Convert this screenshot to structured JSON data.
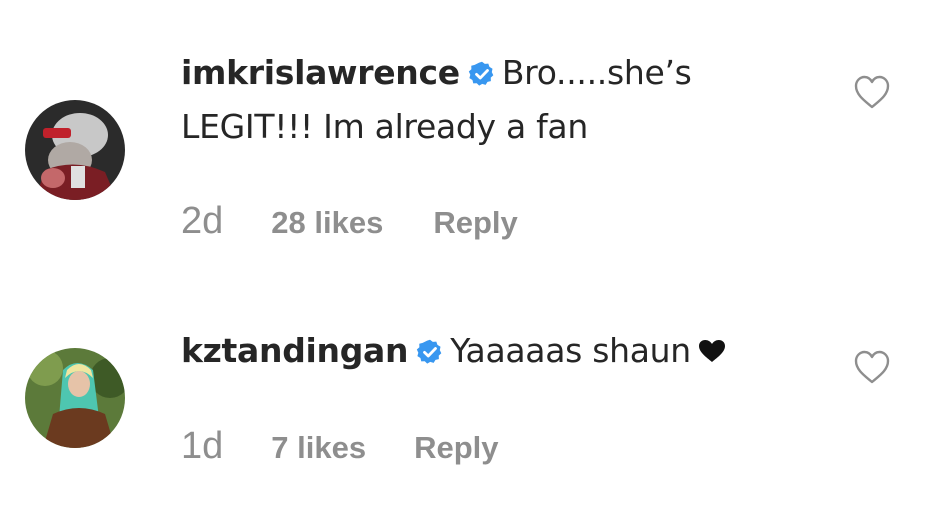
{
  "comments": [
    {
      "username": "imkrislawrence",
      "verified_icon": "verified-badge-icon",
      "text_line1": "Bro.....she’s",
      "text_line2": "LEGIT!!! Im already a fan",
      "time": "2d",
      "likes": "28 likes",
      "reply_label": "Reply",
      "avatar_icon": "avatar-image"
    },
    {
      "username": "kztandingan",
      "verified_icon": "verified-badge-icon",
      "text": "Yaaaaas shaun",
      "emoji": "❤",
      "time": "1d",
      "likes": "7 likes",
      "reply_label": "Reply",
      "avatar_icon": "avatar-image"
    }
  ],
  "colors": {
    "text": "#262626",
    "meta": "#8e8e8e",
    "verified": "#3897f0",
    "heart_outline": "#8e8e8e"
  }
}
